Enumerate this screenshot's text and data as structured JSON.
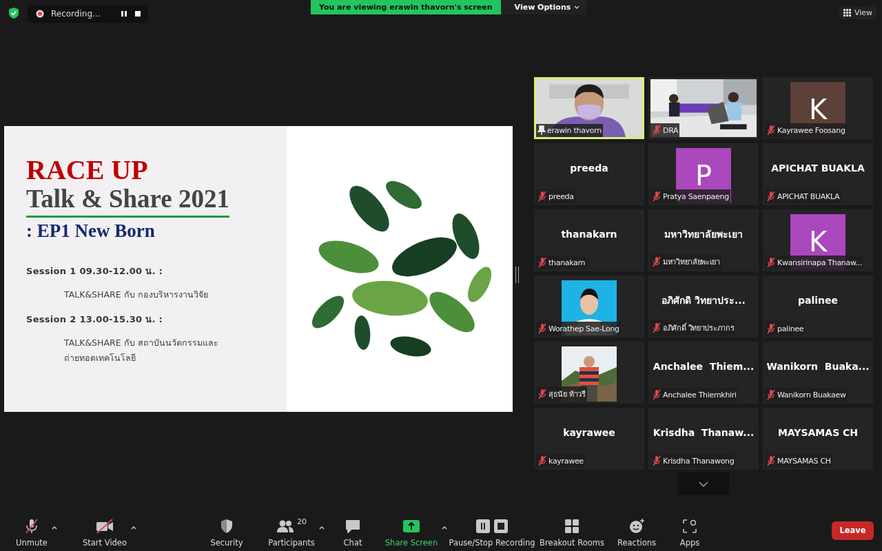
{
  "top_bar": {
    "recording": {
      "label": "Recording..."
    },
    "banner": "You are viewing erawin thavorn's screen",
    "view_options": "View Options",
    "view_button": "View"
  },
  "slide": {
    "title": "RACE UP",
    "subtitle": "Talk & Share 2021",
    "episode": ": EP1 New Born",
    "sessions": [
      {
        "heading": "Session 1 09.30-12.00 น. :",
        "detail": [
          "TALK&SHARE กับ กองบริหารงานวิจัย"
        ]
      },
      {
        "heading": "Session 2 13.00-15.30 น. :",
        "detail": [
          "TALK&SHARE กับ สถาบันนวัตกรรมและ",
          "ถ่ายทอดเทคโนโลยี"
        ]
      }
    ]
  },
  "gallery": [
    {
      "kind": "video",
      "label": "erawin thavorn",
      "pinned": true,
      "muted": false,
      "speaking": true
    },
    {
      "kind": "video",
      "label": "DRA",
      "pinned": false,
      "muted": true,
      "speaking": false
    },
    {
      "kind": "avatar",
      "letter": "K",
      "color": "#5d4037",
      "label": "Kayrawee Foosang",
      "pinned": false,
      "muted": true,
      "speaking": false
    },
    {
      "kind": "name",
      "display": "preeda",
      "label": "preeda",
      "pinned": false,
      "muted": true,
      "speaking": false
    },
    {
      "kind": "avatar",
      "letter": "P",
      "color": "#ab47bc",
      "label": "Pratya Saenpaeng",
      "pinned": false,
      "muted": true,
      "speaking": false
    },
    {
      "kind": "name",
      "display": "APICHAT BUAKLA",
      "label": "APICHAT BUAKLA",
      "pinned": false,
      "muted": true,
      "speaking": false
    },
    {
      "kind": "name",
      "display": "thanakarn",
      "label": "thanakarn",
      "pinned": false,
      "muted": true,
      "speaking": false
    },
    {
      "kind": "name",
      "display": "มหาวิทยาลัยพะเยา",
      "label": "มหาวิทยาลัยพะเยา",
      "pinned": false,
      "muted": true,
      "speaking": false
    },
    {
      "kind": "avatar",
      "letter": "K",
      "color": "#ab47bc",
      "label": "Kwansirinapa Thanaw...",
      "pinned": false,
      "muted": true,
      "speaking": false
    },
    {
      "label": "Worathep Sae-Long",
      "pinned": false,
      "muted": true,
      "speaking": false
    },
    {
      "kind": "name",
      "display": "อภิศักดิ วิทยาประ...",
      "label": "อภิศักดิ์ วิทยาประภากร",
      "pinned": false,
      "muted": true,
      "speaking": false
    },
    {
      "kind": "name",
      "display": "palinee",
      "label": "palinee",
      "pinned": false,
      "muted": true,
      "speaking": false
    },
    {
      "label": "สุธนัย ท้าวรี",
      "pinned": false,
      "muted": true,
      "speaking": false
    },
    {
      "kind": "name",
      "display": "Anchalee  Thiem...",
      "label": "Anchalee Thiemkhiri",
      "pinned": false,
      "muted": true,
      "speaking": false
    },
    {
      "kind": "name",
      "display": "Wanikorn  Buaka...",
      "label": "Wanikorn Buakaew",
      "pinned": false,
      "muted": true,
      "speaking": false
    },
    {
      "kind": "name",
      "display": "kayrawee",
      "label": "kayrawee",
      "pinned": false,
      "muted": true,
      "speaking": false
    },
    {
      "kind": "name",
      "display": "Krisdha  Thanaw...",
      "label": "Krisdha Thanawong",
      "pinned": false,
      "muted": true,
      "speaking": false
    },
    {
      "kind": "name",
      "display": "MAYSAMAS CH",
      "label": "MAYSAMAS CH",
      "pinned": false,
      "muted": true,
      "speaking": false
    }
  ],
  "toolbar": {
    "left": [
      {
        "kind": "mic",
        "label": "Unmute",
        "off": true,
        "caret": true
      },
      {
        "kind": "video",
        "label": "Start Video",
        "off": true,
        "caret": true
      }
    ],
    "center": [
      {
        "kind": "security",
        "label": "Security",
        "caret": false
      },
      {
        "kind": "participants",
        "label": "Participants",
        "count": "20",
        "caret": true
      },
      {
        "kind": "chat",
        "label": "Chat",
        "caret": false
      },
      {
        "kind": "share",
        "label": "Share Screen",
        "caret": true,
        "active": true
      },
      {
        "kind": "record",
        "label": "Pause/Stop Recording",
        "caret": false
      },
      {
        "kind": "breakout",
        "label": "Breakout Rooms",
        "caret": false
      },
      {
        "kind": "reactions",
        "label": "Reactions",
        "caret": false
      },
      {
        "kind": "apps",
        "label": "Apps",
        "caret": false
      }
    ],
    "leave": "Leave"
  }
}
